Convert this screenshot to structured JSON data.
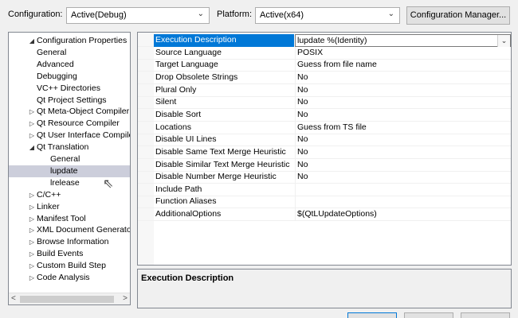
{
  "header": {
    "configuration_label": "Configuration:",
    "configuration_value": "Active(Debug)",
    "platform_label": "Platform:",
    "platform_value": "Active(x64)",
    "configuration_manager_label": "Configuration Manager...",
    "dropdown_glyph": "⌄"
  },
  "tree": {
    "expanded_arrow": "◢",
    "collapsed_arrow": "▷",
    "items": [
      {
        "label": "Configuration Properties",
        "arrow": "expanded"
      },
      {
        "label": "General",
        "arrow": "none"
      },
      {
        "label": "Advanced",
        "arrow": "none"
      },
      {
        "label": "Debugging",
        "arrow": "none"
      },
      {
        "label": "VC++ Directories",
        "arrow": "none"
      },
      {
        "label": "Qt Project Settings",
        "arrow": "none"
      },
      {
        "label": "Qt Meta-Object Compiler",
        "arrow": "collapsed"
      },
      {
        "label": "Qt Resource Compiler",
        "arrow": "collapsed"
      },
      {
        "label": "Qt User Interface Compiler",
        "arrow": "collapsed"
      },
      {
        "label": "Qt Translation",
        "arrow": "expanded"
      },
      {
        "label": "General",
        "arrow": "none"
      },
      {
        "label": "lupdate",
        "arrow": "none",
        "selected": true
      },
      {
        "label": "lrelease",
        "arrow": "none"
      },
      {
        "label": "C/C++",
        "arrow": "collapsed"
      },
      {
        "label": "Linker",
        "arrow": "collapsed"
      },
      {
        "label": "Manifest Tool",
        "arrow": "collapsed"
      },
      {
        "label": "XML Document Generator",
        "arrow": "collapsed"
      },
      {
        "label": "Browse Information",
        "arrow": "collapsed"
      },
      {
        "label": "Build Events",
        "arrow": "collapsed"
      },
      {
        "label": "Custom Build Step",
        "arrow": "collapsed"
      },
      {
        "label": "Code Analysis",
        "arrow": "collapsed"
      }
    ],
    "scroll_left": "<",
    "scroll_right": ">"
  },
  "grid": {
    "rows": [
      {
        "name": "Execution Description",
        "value": "lupdate %(Identity)",
        "selected": true
      },
      {
        "name": "Source Language",
        "value": "POSIX"
      },
      {
        "name": "Target Language",
        "value": "Guess from file name"
      },
      {
        "name": "Drop Obsolete Strings",
        "value": "No"
      },
      {
        "name": "Plural Only",
        "value": "No"
      },
      {
        "name": "Silent",
        "value": "No"
      },
      {
        "name": "Disable Sort",
        "value": "No"
      },
      {
        "name": "Locations",
        "value": "Guess from TS file"
      },
      {
        "name": "Disable UI Lines",
        "value": "No"
      },
      {
        "name": "Disable Same Text Merge Heuristic",
        "value": "No"
      },
      {
        "name": "Disable Similar Text Merge Heuristic",
        "value": "No"
      },
      {
        "name": "Disable Number Merge Heuristic",
        "value": "No"
      },
      {
        "name": "Include Path",
        "value": ""
      },
      {
        "name": "Function Aliases",
        "value": ""
      },
      {
        "name": "AdditionalOptions",
        "value": "$(QtLUpdateOptions)"
      }
    ]
  },
  "description": {
    "title": "Execution Description"
  },
  "colors": {
    "selection_blue": "#0078d7",
    "tree_selection": "#cccedb"
  }
}
